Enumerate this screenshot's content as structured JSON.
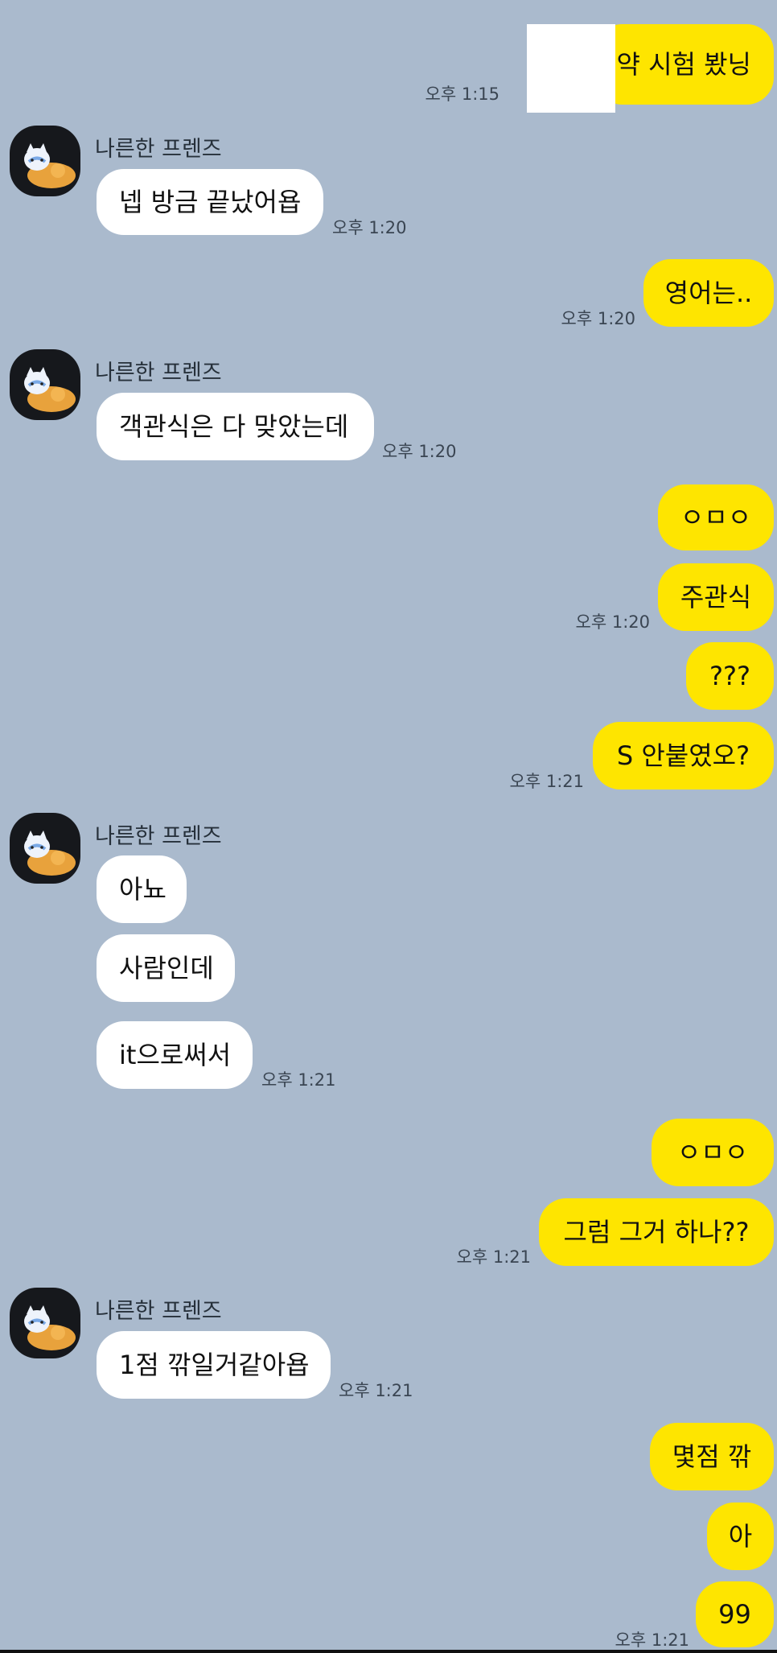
{
  "colors": {
    "background": "#aabacd",
    "outgoing_bubble": "#fee500",
    "incoming_bubble": "#ffffff",
    "redaction_box": "#ffffff"
  },
  "avatar_icon": "cat-and-dog-character-icon",
  "messages": [
    {
      "text": "약 시험 봤닝",
      "time": "오후 1:15"
    },
    {
      "sender": "나른한 프렌즈",
      "text": "넵 방금 끝났어욥",
      "time": "오후 1:20"
    },
    {
      "text": "영어는..",
      "time": "오후 1:20"
    },
    {
      "sender": "나른한 프렌즈",
      "text": "객관식은 다 맞았는데",
      "time": "오후 1:20"
    },
    {
      "text": "ㅇㅁㅇ"
    },
    {
      "text": "주관식",
      "time": "오후 1:20"
    },
    {
      "text": "???"
    },
    {
      "text": "S 안붙였오?",
      "time": "오후 1:21"
    },
    {
      "sender": "나른한 프렌즈",
      "text": "아뇨"
    },
    {
      "text": "사람인데"
    },
    {
      "text": "it으로써서",
      "time": "오후 1:21"
    },
    {
      "text": "ㅇㅁㅇ"
    },
    {
      "text": "그럼 그거 하나??",
      "time": "오후 1:21"
    },
    {
      "sender": "나른한 프렌즈",
      "text": "1점 깎일거같아욥",
      "time": "오후 1:21"
    },
    {
      "text": "몇점 깎"
    },
    {
      "text": "아"
    },
    {
      "text": "99",
      "time": "오후 1:21"
    }
  ]
}
